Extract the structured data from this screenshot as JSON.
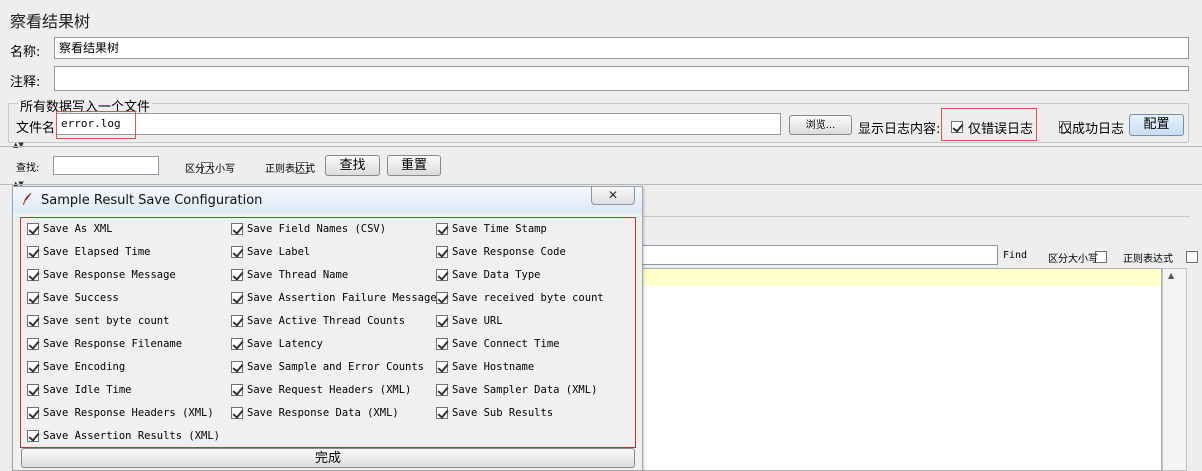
{
  "window": {
    "title": "察看结果树"
  },
  "form": {
    "name_label": "名称:",
    "name_value": "察看结果树",
    "comment_label": "注释:",
    "comment_value": ""
  },
  "file_section": {
    "legend": "所有数据写入一个文件",
    "filename_label": "文件名",
    "filename_value": "error.log",
    "browse_label": "浏览...",
    "log_display_label": "显示日志内容:",
    "errors_only_label": "仅错误日志",
    "errors_only_checked": true,
    "success_only_label": "仅成功日志",
    "success_only_checked": false,
    "configure_label": "配置"
  },
  "search_bar": {
    "search_label": "查找:",
    "search_value": "",
    "case_sensitive_label": "区分大小写",
    "regex_label": "正则表达式",
    "find_button": "查找",
    "reset_button": "重置"
  },
  "right_panel": {
    "find_label": "Find",
    "case_sensitive_label": "区分大小写",
    "regex_label": "正则表达式"
  },
  "dialog": {
    "title": "Sample Result Save Configuration",
    "done_button": "完成",
    "options": [
      [
        "Save As XML",
        "Save Field Names (CSV)",
        "Save Time Stamp"
      ],
      [
        "Save Elapsed Time",
        "Save Label",
        "Save Response Code"
      ],
      [
        "Save Response Message",
        "Save Thread Name",
        "Save Data Type"
      ],
      [
        "Save Success",
        "Save Assertion Failure Message",
        "Save received byte count"
      ],
      [
        "Save sent byte count",
        "Save Active Thread Counts",
        "Save URL"
      ],
      [
        "Save Response Filename",
        "Save Latency",
        "Save Connect Time"
      ],
      [
        "Save Encoding",
        "Save Sample and Error Counts",
        "Save Hostname"
      ],
      [
        "Save Idle Time",
        "Save Request Headers (XML)",
        "Save Sampler Data (XML)"
      ],
      [
        "Save Response Headers (XML)",
        "Save Response Data (XML)",
        "Save Sub Results"
      ],
      [
        "Save Assertion Results (XML)"
      ]
    ]
  },
  "colors": {
    "highlight_border": "#d9534f",
    "row_highlight": "#ffffc8"
  }
}
